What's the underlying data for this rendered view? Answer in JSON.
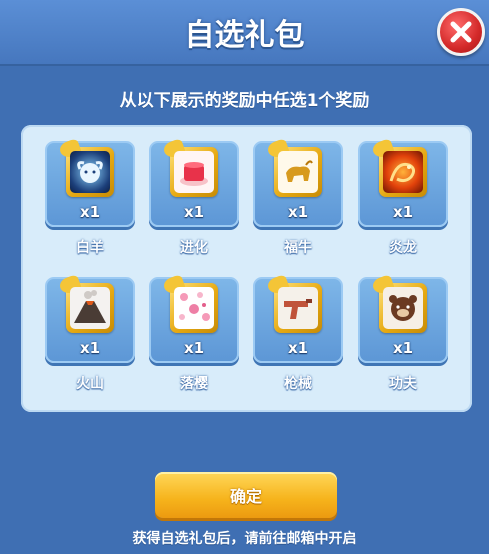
{
  "dialog": {
    "title": "自选礼包",
    "subtitle": "从以下展示的奖励中任选1个奖励",
    "confirm_label": "确定",
    "footer_note": "获得自选礼包后，请前往邮箱中开启"
  },
  "rewards": [
    {
      "name": "白羊",
      "qty": "x1",
      "icon": "aries-icon"
    },
    {
      "name": "进化",
      "qty": "x1",
      "icon": "evolve-cake-icon"
    },
    {
      "name": "福牛",
      "qty": "x1",
      "icon": "lucky-ox-icon"
    },
    {
      "name": "炎龙",
      "qty": "x1",
      "icon": "flame-dragon-icon"
    },
    {
      "name": "火山",
      "qty": "x1",
      "icon": "volcano-icon"
    },
    {
      "name": "落樱",
      "qty": "x1",
      "icon": "cherry-blossom-icon"
    },
    {
      "name": "枪械",
      "qty": "x1",
      "icon": "pistol-icon"
    },
    {
      "name": "功夫",
      "qty": "x1",
      "icon": "kungfu-bear-icon"
    }
  ],
  "colors": {
    "background": "#3f6fb3",
    "panel": "#d8ecfa",
    "confirm_button": "#f6b31b",
    "close_button": "#d32929"
  }
}
